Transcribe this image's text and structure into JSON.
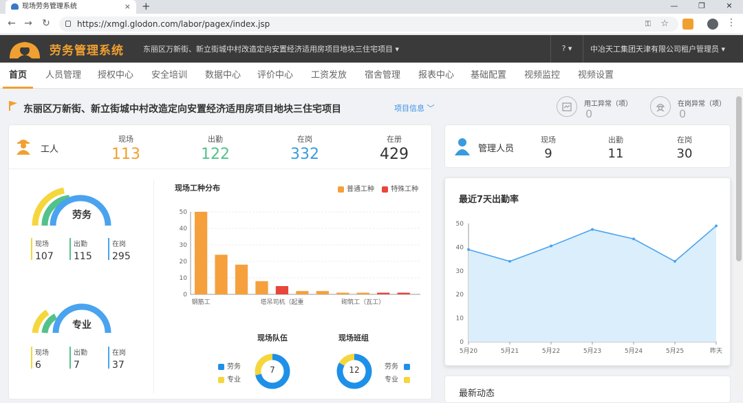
{
  "browser": {
    "tab_title": "现场劳务管理系统",
    "tab_close": "×",
    "new_tab": "+",
    "url": "https://xmgl.glodon.com/labor/pagex/index.jsp",
    "window_controls": [
      "—",
      "❐",
      "✕"
    ],
    "nav_icons": [
      "arrow-left-icon",
      "arrow-right-icon",
      "reload-icon"
    ]
  },
  "header": {
    "app_name": "劳务管理系统",
    "project_select": "东丽区万新街、新立街城中村改造定向安置经济适用房项目地块三住宅项目 ▾",
    "help": "? ▾",
    "user": "中冶天工集团天津有限公司租户管理员 ▾",
    "colors": {
      "bar": "#3a3a3a",
      "brand": "#f0a030"
    }
  },
  "nav": {
    "items": [
      "首页",
      "人员管理",
      "授权中心",
      "安全培训",
      "数据中心",
      "评价中心",
      "工资发放",
      "宿舍管理",
      "报表中心",
      "基础配置",
      "视频监控",
      "视频设置"
    ],
    "active": "首页"
  },
  "project": {
    "title": "东丽区万新街、新立街城中村改造定向安置经济适用房项目地块三住宅项目",
    "info_link": "项目信息 ﹀",
    "abnormal": [
      {
        "label": "用工异常（项）",
        "value": "0",
        "icon": "calendar-icon"
      },
      {
        "label": "在岗异常（项）",
        "value": "0",
        "icon": "worker-helmet-icon"
      }
    ]
  },
  "workers": {
    "title": "工人",
    "stats": [
      {
        "label": "现场",
        "value": "113",
        "color": "#f0a030"
      },
      {
        "label": "出勤",
        "value": "122",
        "color": "#52c28a"
      },
      {
        "label": "在岗",
        "value": "332",
        "color": "#3a9bdc"
      },
      {
        "label": "在册",
        "value": "429",
        "color": "#333333"
      }
    ],
    "labor": {
      "title": "劳务",
      "items": [
        {
          "label": "现场",
          "value": "107",
          "color": "#f5d63d"
        },
        {
          "label": "出勤",
          "value": "115",
          "color": "#52c28a"
        },
        {
          "label": "在岗",
          "value": "295",
          "color": "#4aa3ef"
        }
      ]
    },
    "professional": {
      "title": "专业",
      "items": [
        {
          "label": "现场",
          "value": "6",
          "color": "#f5d63d"
        },
        {
          "label": "出勤",
          "value": "7",
          "color": "#52c28a"
        },
        {
          "label": "在岗",
          "value": "37",
          "color": "#4aa3ef"
        }
      ]
    }
  },
  "team": {
    "title": "现场队伍",
    "center": "7",
    "legend": [
      "劳务",
      "专业"
    ]
  },
  "group": {
    "title": "现场班组",
    "center": "12",
    "legend": [
      "劳务",
      "专业"
    ]
  },
  "managers": {
    "title": "管理人员",
    "stats": [
      {
        "label": "现场",
        "value": "9"
      },
      {
        "label": "出勤",
        "value": "11"
      },
      {
        "label": "在岗",
        "value": "30"
      }
    ]
  },
  "rate": {
    "title": "最近7天出勤率"
  },
  "news": {
    "title": "最新动态"
  },
  "chart_data": [
    {
      "type": "bar",
      "title": "现场工种分布",
      "series": [
        {
          "name": "普通工种",
          "color": "#f5a03d",
          "values": [
            50,
            24,
            18,
            8,
            0,
            2,
            2,
            1,
            1,
            0,
            0
          ]
        },
        {
          "name": "特殊工种",
          "color": "#e8463a",
          "values": [
            0,
            0,
            0,
            0,
            5,
            0,
            0,
            0,
            0,
            1,
            1
          ]
        }
      ],
      "category_labels": [
        "钢筋工",
        "塔吊司机（起重",
        "砌筑工（瓦工）"
      ],
      "label_positions": [
        0,
        4,
        8
      ],
      "ylim": [
        0,
        50
      ],
      "yticks": [
        0,
        10,
        20,
        30,
        40,
        50
      ],
      "grid": true,
      "legend": "top-right"
    },
    {
      "type": "area",
      "title": "最近7天出勤率",
      "categories": [
        "5月20",
        "5月21",
        "5月22",
        "5月23",
        "5月24",
        "5月25",
        "昨天"
      ],
      "values": [
        39,
        34,
        40.5,
        47.5,
        43.5,
        34,
        49
      ],
      "ylim": [
        0,
        50
      ],
      "yticks": [
        0,
        10,
        20,
        30,
        40,
        50
      ],
      "line_color": "#4aa3ef",
      "fill_color": "#dbeefc"
    },
    {
      "type": "pie",
      "title": "现场队伍",
      "center_value": 7,
      "slices": [
        {
          "name": "劳务",
          "value": 5,
          "color": "#1e90e8"
        },
        {
          "name": "专业",
          "value": 2,
          "color": "#f5d63d"
        }
      ]
    },
    {
      "type": "pie",
      "title": "现场班组",
      "center_value": 12,
      "slices": [
        {
          "name": "劳务",
          "value": 10,
          "color": "#1e90e8"
        },
        {
          "name": "专业",
          "value": 2,
          "color": "#f5d63d"
        }
      ]
    }
  ]
}
